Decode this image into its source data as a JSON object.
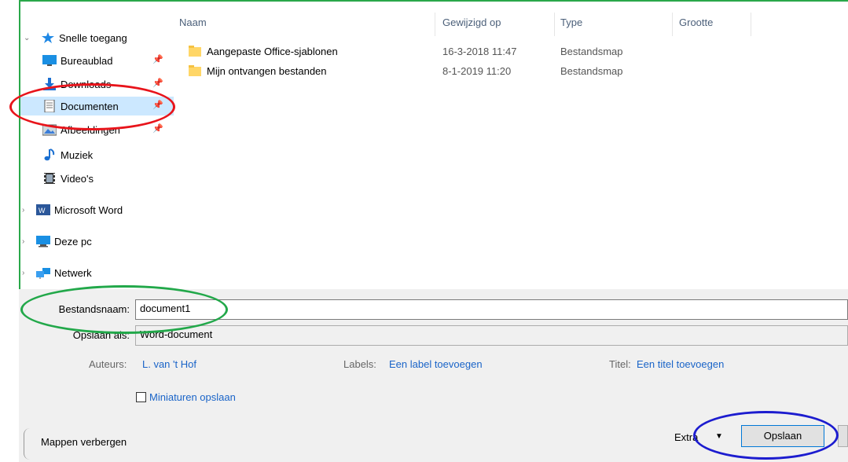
{
  "sidebar": {
    "items": [
      {
        "label": "Snelle toegang",
        "icon": "star-icon"
      },
      {
        "label": "Bureaublad",
        "icon": "desktop-icon"
      },
      {
        "label": "Downloads",
        "icon": "download-icon"
      },
      {
        "label": "Documenten",
        "icon": "document-icon"
      },
      {
        "label": "Afbeeldingen",
        "icon": "pictures-icon"
      },
      {
        "label": "Muziek",
        "icon": "music-icon"
      },
      {
        "label": "Video's",
        "icon": "video-icon"
      },
      {
        "label": "Microsoft Word",
        "icon": "word-icon"
      },
      {
        "label": "Deze pc",
        "icon": "computer-icon"
      },
      {
        "label": "Netwerk",
        "icon": "network-icon"
      }
    ]
  },
  "file_list": {
    "columns": [
      "Naam",
      "Gewijzigd op",
      "Type",
      "Grootte"
    ],
    "rows": [
      {
        "name": "Aangepaste Office-sjablonen",
        "date": "16-3-2018 11:47",
        "type": "Bestandsmap"
      },
      {
        "name": "Mijn ontvangen bestanden",
        "date": "8-1-2019 11:20",
        "type": "Bestandsmap"
      }
    ]
  },
  "form": {
    "filename_label": "Bestandsnaam:",
    "filename_value": "document1",
    "savetype_label": "Opslaan als:",
    "savetype_value": "Word-document",
    "authors_label": "Auteurs:",
    "authors_value": "L. van 't Hof",
    "tags_label": "Labels:",
    "tags_value": "Een label toevoegen",
    "title_label": "Titel:",
    "title_value": "Een titel toevoegen",
    "thumbnail_label": "Miniaturen opslaan"
  },
  "footer": {
    "hide_folders": "Mappen verbergen",
    "tools": "Extra",
    "save": "Opslaan"
  },
  "colors": {
    "highlight_red": "#e8141b",
    "highlight_green": "#22a84a",
    "highlight_blue": "#1c1ccf",
    "selection": "#cce8ff",
    "link": "#1a64c8"
  }
}
